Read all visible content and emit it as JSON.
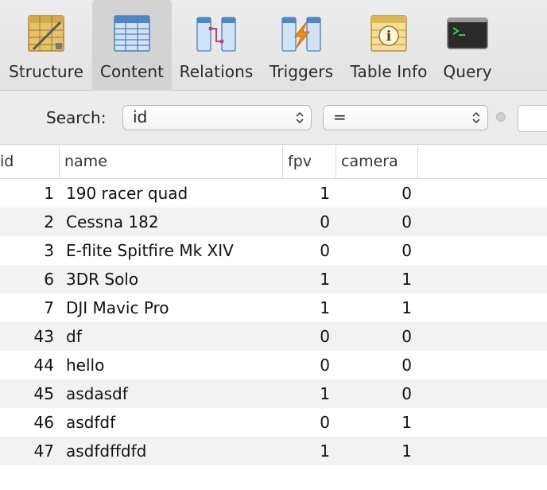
{
  "toolbar": {
    "tabs": [
      {
        "label": "Structure",
        "icon": "structure-icon"
      },
      {
        "label": "Content",
        "icon": "content-icon",
        "active": true
      },
      {
        "label": "Relations",
        "icon": "relations-icon"
      },
      {
        "label": "Triggers",
        "icon": "triggers-icon"
      },
      {
        "label": "Table Info",
        "icon": "table-info-icon"
      },
      {
        "label": "Query",
        "icon": "query-icon"
      }
    ]
  },
  "filter": {
    "search_label": "Search:",
    "field_value": "id",
    "operator_value": "="
  },
  "table": {
    "columns": [
      "id",
      "name",
      "fpv",
      "camera"
    ],
    "rows": [
      {
        "id": "1",
        "name": "190 racer quad",
        "fpv": "1",
        "camera": "0"
      },
      {
        "id": "2",
        "name": "Cessna 182",
        "fpv": "0",
        "camera": "0"
      },
      {
        "id": "3",
        "name": "E-flite Spitfire Mk XIV",
        "fpv": "0",
        "camera": "0"
      },
      {
        "id": "6",
        "name": "3DR Solo",
        "fpv": "1",
        "camera": "1"
      },
      {
        "id": "7",
        "name": "DJI Mavic Pro",
        "fpv": "1",
        "camera": "1"
      },
      {
        "id": "43",
        "name": "df",
        "fpv": "0",
        "camera": "0"
      },
      {
        "id": "44",
        "name": "hello",
        "fpv": "0",
        "camera": "0"
      },
      {
        "id": "45",
        "name": "asdasdf",
        "fpv": "1",
        "camera": "0"
      },
      {
        "id": "46",
        "name": "asdfdf",
        "fpv": "0",
        "camera": "1"
      },
      {
        "id": "47",
        "name": "asdfdffdfd",
        "fpv": "1",
        "camera": "1"
      }
    ]
  },
  "colors": {
    "toolbar_bg": "#e6e6e6",
    "active_tab_bg": "#d3d3d3",
    "row_alt_bg": "#f2f2f2"
  }
}
